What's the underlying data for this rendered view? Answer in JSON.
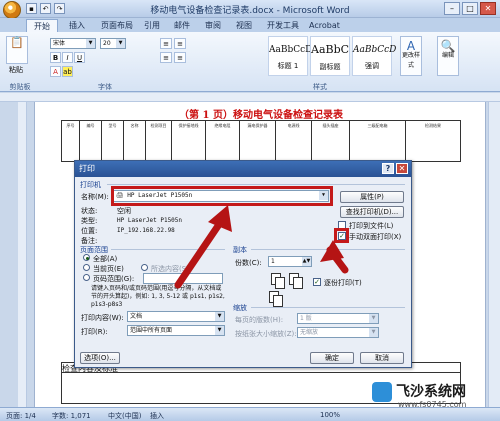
{
  "window": {
    "title": "移动电气设备检查记录表.docx - Microsoft Word"
  },
  "tabs": [
    "开始",
    "插入",
    "页面布局",
    "引用",
    "邮件",
    "审阅",
    "视图",
    "开发工具",
    "Acrobat"
  ],
  "ribbon": {
    "paste": "粘贴",
    "font_name": "宋体",
    "font_size": "20",
    "styles": [
      {
        "sample": "AaBbCcD",
        "name": "标题 1"
      },
      {
        "sample": "AaBbC",
        "name": "副标题"
      },
      {
        "sample": "AaBbCcD",
        "name": "强调"
      }
    ],
    "change_styles": "更改样式",
    "edit": "编辑",
    "groups": [
      "剪贴板",
      "字体",
      "样式"
    ]
  },
  "document": {
    "title": "（第 1 页）移动电气设备检查记录表",
    "columns": [
      "序号",
      "编号",
      "型号",
      "名称",
      "检测项目",
      "保护接地线",
      "绝缘电阻",
      "漏电保护器",
      "电源线",
      "插头插座",
      "三级配电箱",
      "检测结果"
    ],
    "header_note": "检查内容及标准"
  },
  "dialog": {
    "title": "打印",
    "printer_section": "打印机",
    "name_label": "名称(M):",
    "name_value": "HP LaserJet P1505n",
    "status_label": "状态:",
    "status_value": "空闲",
    "type_label": "类型:",
    "type_value": "HP LaserJet P1505n",
    "where_label": "位置:",
    "where_value": "IP_192.168.22.98",
    "comment_label": "备注:",
    "properties_button": "属性(P)",
    "find_printer_button": "查找打印机(D)...",
    "print_to_file": "打印到文件(L)",
    "manual_duplex": "手动双面打印(X)",
    "page_range_section": "页面范围",
    "all": "全部(A)",
    "current_page": "当前页(E)",
    "selection": "所选内容(S)",
    "pages": "页码范围(G):",
    "pages_hint": "请键入页码和/或页码范围(用逗号分隔，从文档或节的开头算起)，例如: 1, 3, 5-12 或 p1s1, p1s2, p1s3-p8s3",
    "copies_section": "副本",
    "copies_label": "份数(C):",
    "copies_value": "1",
    "collate": "逐份打印(T)",
    "print_what_label": "打印内容(W):",
    "print_what_value": "文档",
    "print_label": "打印(R):",
    "print_value": "范围中所有页面",
    "zoom_section": "缩放",
    "pages_per_sheet_label": "每页的版数(H):",
    "pages_per_sheet_value": "1 版",
    "scale_label": "按纸张大小缩放(Z):",
    "scale_value": "无缩放",
    "options_button": "选项(O)...",
    "ok_button": "确定",
    "cancel_button": "取消"
  },
  "status_bar": {
    "page": "页面: 1/4",
    "words": "字数: 1,071",
    "language": "中文(中国)",
    "mode": "插入",
    "zoom": "100%"
  },
  "watermark": {
    "text": "飞沙系统网",
    "url": "www.fs0745.com"
  }
}
